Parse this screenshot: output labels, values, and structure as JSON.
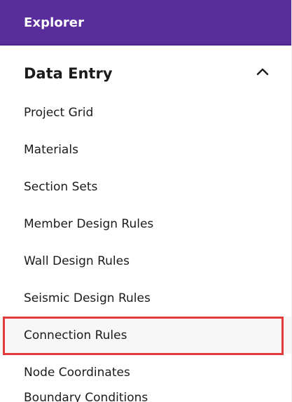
{
  "header": {
    "title": "Explorer",
    "background": "#5a2d9c"
  },
  "section": {
    "title": "Data Entry",
    "expanded": true,
    "toggle_icon": "chevron-up-icon"
  },
  "items": [
    {
      "label": "Project Grid"
    },
    {
      "label": "Materials"
    },
    {
      "label": "Section Sets"
    },
    {
      "label": "Member Design Rules"
    },
    {
      "label": "Wall Design Rules"
    },
    {
      "label": "Seismic Design Rules"
    },
    {
      "label": "Connection Rules"
    },
    {
      "label": "Node Coordinates"
    }
  ],
  "highlight": {
    "item": "Connection Rules",
    "color": "#e33b3b"
  },
  "partial_item": {
    "label": "Boundary Conditions"
  }
}
